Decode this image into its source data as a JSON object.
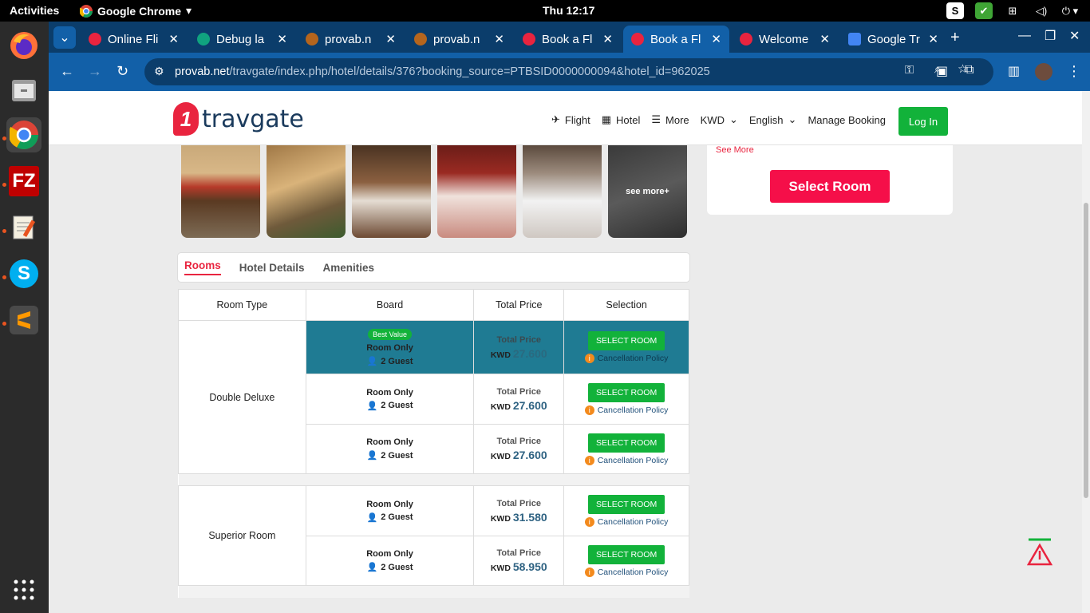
{
  "system": {
    "activities": "Activities",
    "app_name": "Google Chrome",
    "clock": "Thu 12:17"
  },
  "tabs": [
    {
      "label": "Online Fli",
      "color": "#e9243f"
    },
    {
      "label": "Debug la",
      "color": "#10a37f"
    },
    {
      "label": "provab.n",
      "color": "#b5651d"
    },
    {
      "label": "provab.n",
      "color": "#b5651d"
    },
    {
      "label": "Book a Fl",
      "color": "#e9243f"
    },
    {
      "label": "Book a Fl",
      "color": "#e9243f",
      "active": true
    },
    {
      "label": "Welcome",
      "color": "#e9243f"
    },
    {
      "label": "Google Tr",
      "color": "#4285f4"
    }
  ],
  "url": {
    "host": "provab.net",
    "path": "/travgate/index.php/hotel/details/376?booking_source=PTBSID0000000094&hotel_id=962025"
  },
  "site": {
    "logo_text": "travgate",
    "nav": {
      "flight": "Flight",
      "hotel": "Hotel",
      "more": "More",
      "currency": "KWD",
      "language": "English",
      "manage": "Manage Booking",
      "login": "Log In"
    },
    "see_more_plus": "see more+",
    "see_more": "See More",
    "select_room_big": "Select Room"
  },
  "content_tabs": {
    "rooms": "Rooms",
    "details": "Hotel Details",
    "amenities": "Amenities"
  },
  "table": {
    "headers": [
      "Room Type",
      "Board",
      "Total Price",
      "Selection"
    ],
    "best_value": "Best Value",
    "total_price_label": "Total Price",
    "currency": "KWD",
    "select_label": "SELECT ROOM",
    "cancel_label": "Cancellation Policy",
    "groups": [
      {
        "room_type": "Double Deluxe",
        "rows": [
          {
            "board": "Room Only",
            "guests": "2 Guest",
            "price": "27.600",
            "highlight": true
          },
          {
            "board": "Room Only",
            "guests": "2 Guest",
            "price": "27.600"
          },
          {
            "board": "Room Only",
            "guests": "2 Guest",
            "price": "27.600"
          }
        ]
      },
      {
        "room_type": "Superior Room",
        "rows": [
          {
            "board": "Room Only",
            "guests": "2 Guest",
            "price": "31.580"
          },
          {
            "board": "Room Only",
            "guests": "2 Guest",
            "price": "58.950"
          }
        ]
      }
    ]
  }
}
